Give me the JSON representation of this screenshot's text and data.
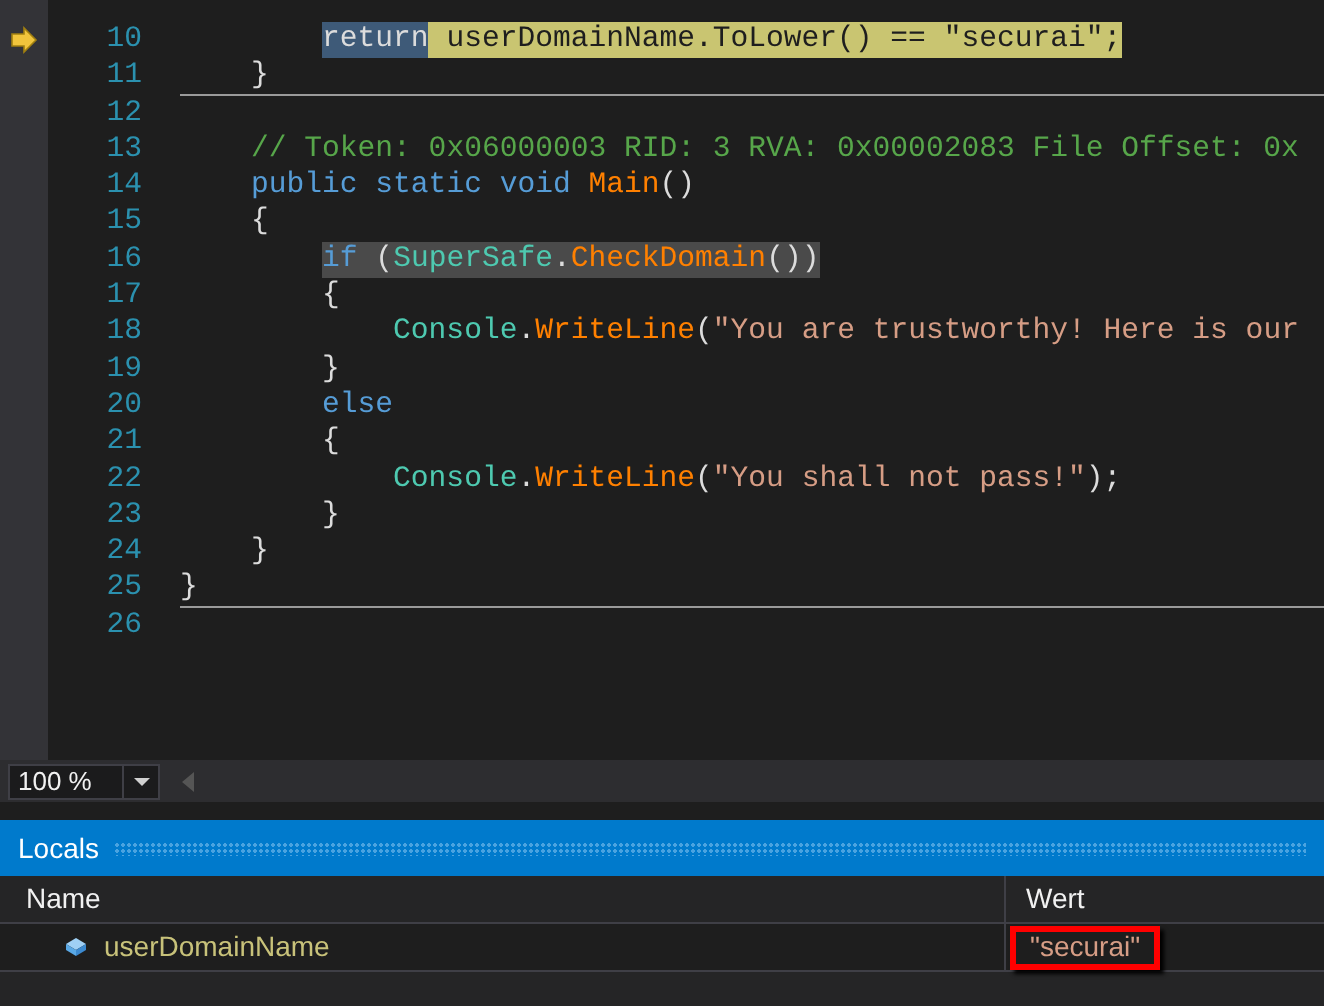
{
  "editor": {
    "lines": [
      {
        "children": [
          {
            "children": [
              {
                "number": "10",
                "current": true,
                "tokens": [
                  {
                    "text": "return",
                    "selected": true
                  },
                  {
                    "text": " userDomainName.ToLower() == \"securai\";",
                    "selected": false
                  }
                ]
              }
            ]
          },
          {
            "number": "11",
            "current": false,
            "highlighted": false,
            "separator_after": true,
            "tokens": [
              {
                "text": "}",
                "kind": "plain"
              }
            ]
          }
        ]
      },
      {
        "number": "12",
        "current": false,
        "highlighted": false
      },
      {
        "children": [
          {
            "number": "13",
            "current": false,
            "highlighted": false,
            "tokens": [
              {
                "text": "// Token: 0x06000003 RID: 3 RVA: 0x00002083 File Offset: 0x",
                "kind": "comment"
              }
            ]
          },
          {
            "number": "14",
            "current": false,
            "highlighted": false,
            "tokens": [
              {
                "text": "public static void ",
                "kind": "keyword"
              },
              {
                "text": "Main",
                "kind": "method"
              },
              {
                "text": "()",
                "kind": "plain"
              }
            ]
          },
          {
            "number": "15",
            "current": false,
            "highlighted": false,
            "tokens": [
              {
                "text": "{",
                "kind": "plain"
              }
            ]
          },
          {
            "children": [
              {
                "number": "16",
                "current": false,
                "highlighted": true,
                "tokens": [
                  {
                    "text": "if ",
                    "kind": "keyword"
                  },
                  {
                    "text": "(",
                    "kind": "plain"
                  },
                  {
                    "text": "SuperSafe",
                    "kind": "type"
                  },
                  {
                    "text": ".",
                    "kind": "plain"
                  },
                  {
                    "text": "CheckDomain",
                    "kind": "method"
                  },
                  {
                    "text": "())",
                    "kind": "plain"
                  }
                ]
              },
              {
                "number": "17",
                "current": false,
                "highlighted": false,
                "tokens": [
                  {
                    "text": "{",
                    "kind": "plain"
                  }
                ]
              },
              {
                "children": [
                  {
                    "number": "18",
                    "current": false,
                    "highlighted": false,
                    "tokens": [
                      {
                        "text": "Console",
                        "kind": "type"
                      },
                      {
                        "text": ".",
                        "kind": "plain"
                      },
                      {
                        "text": "WriteLine",
                        "kind": "method"
                      },
                      {
                        "text": "(",
                        "kind": "plain"
                      },
                      {
                        "text": "\"You are trustworthy! Here is our",
                        "kind": "string"
                      }
                    ]
                  }
                ]
              },
              {
                "number": "19",
                "current": false,
                "highlighted": false,
                "tokens": [
                  {
                    "text": "}",
                    "kind": "plain"
                  }
                ]
              },
              {
                "number": "20",
                "current": false,
                "highlighted": false,
                "tokens": [
                  {
                    "text": "else",
                    "kind": "keyword"
                  }
                ]
              },
              {
                "number": "21",
                "current": false,
                "highlighted": false,
                "tokens": [
                  {
                    "text": "{",
                    "kind": "plain"
                  }
                ]
              },
              {
                "children": [
                  {
                    "number": "22",
                    "current": false,
                    "highlighted": false,
                    "tokens": [
                      {
                        "text": "Console",
                        "kind": "type"
                      },
                      {
                        "text": ".",
                        "kind": "plain"
                      },
                      {
                        "text": "WriteLine",
                        "kind": "method"
                      },
                      {
                        "text": "(",
                        "kind": "plain"
                      },
                      {
                        "text": "\"You shall not pass!\"",
                        "kind": "string"
                      },
                      {
                        "text": ");",
                        "kind": "plain"
                      }
                    ]
                  }
                ]
              },
              {
                "number": "23",
                "current": false,
                "highlighted": false,
                "tokens": [
                  {
                    "text": "}",
                    "kind": "plain"
                  }
                ]
              }
            ]
          },
          {
            "number": "24",
            "current": false,
            "highlighted": false,
            "tokens": [
              {
                "text": "}",
                "kind": "plain"
              }
            ]
          }
        ]
      },
      {
        "number": "25",
        "current": false,
        "highlighted": false,
        "separator_after": true,
        "tokens": [
          {
            "text": "}",
            "kind": "plain"
          }
        ]
      },
      {
        "number": "26",
        "current": false,
        "highlighted": false
      }
    ],
    "zoom": "100 %"
  },
  "locals": {
    "title": "Locals",
    "columns": [
      "Name",
      "Wert"
    ],
    "rows": [
      {
        "name": "userDomainName",
        "value": "\"securai\"",
        "marked": true
      }
    ]
  }
}
